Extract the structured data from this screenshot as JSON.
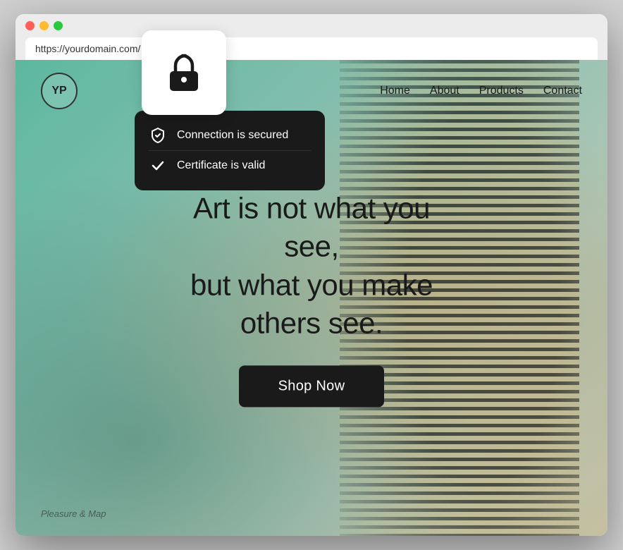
{
  "browser": {
    "traffic_lights": [
      "red",
      "yellow",
      "green"
    ],
    "url": "https://yourdomain.com/"
  },
  "lock_popup": {
    "security_items": [
      {
        "icon": "shield-check-icon",
        "label": "Connection is secured"
      },
      {
        "icon": "checkmark-icon",
        "label": "Certificate is valid"
      }
    ]
  },
  "nav": {
    "logo_text": "YP",
    "links": [
      {
        "label": "Home"
      },
      {
        "label": "About"
      },
      {
        "label": "Products"
      },
      {
        "label": "Contact"
      }
    ]
  },
  "hero": {
    "headline": "Art is not what you see,\nbut what you make\nothers see.",
    "cta_label": "Shop Now"
  },
  "footer_note": "Pleasure & Map"
}
